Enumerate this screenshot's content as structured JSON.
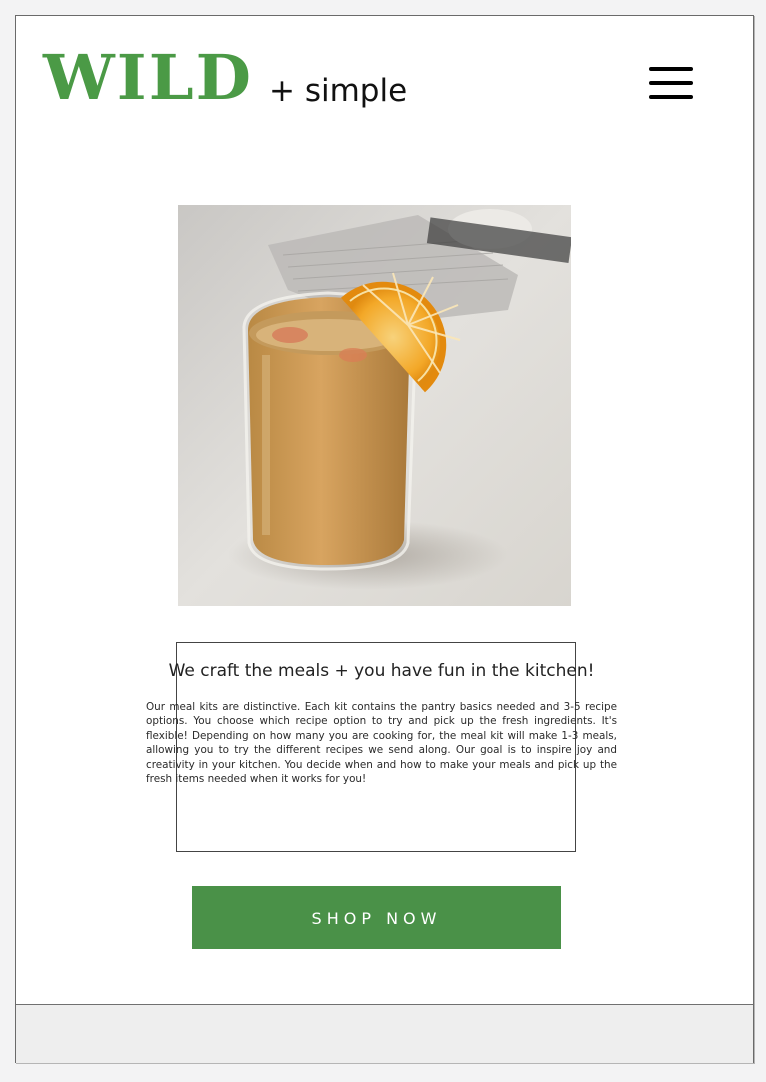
{
  "header": {
    "logo_main": "WILD",
    "logo_sub": "+ simple",
    "menu_icon": "hamburger-menu-icon"
  },
  "hero": {
    "image": "smoothie-glass-with-orange-slice"
  },
  "main": {
    "tagline": "We craft the meals + you have fun in the kitchen!",
    "description": "Our meal kits are distinctive. Each kit contains the pantry basics needed and 3-5 recipe options. You choose which recipe option to try and pick up the fresh ingredients. It's flexible! Depending on how many you are cooking for, the meal kit will make 1-3 meals, allowing you to try the different recipes we send along. Our goal is to inspire joy and creativity in your kitchen. You decide when and how to make your meals and pick up the fresh items needed when it works for you!",
    "cta_label": "SHOP NOW"
  },
  "colors": {
    "brand_green": "#4b9a46",
    "button_green": "#4a9148",
    "text_dark": "#222222",
    "background": "#ffffff",
    "footer_band": "#eeeeee"
  }
}
